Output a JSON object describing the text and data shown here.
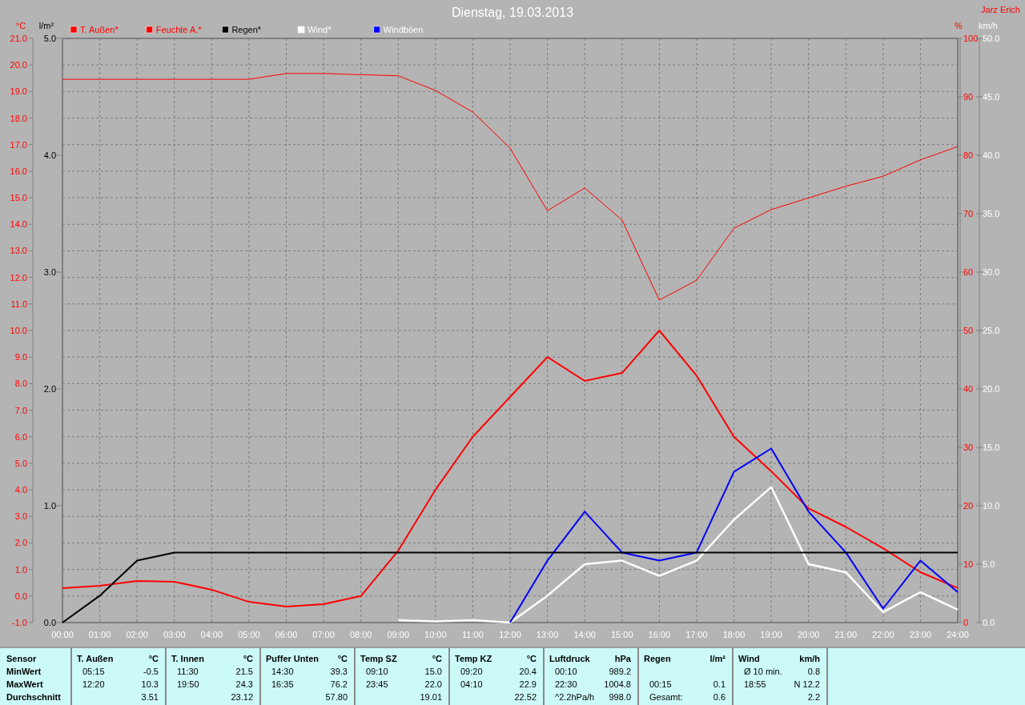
{
  "window": {
    "title": "Dienstag, 19.03.2013",
    "author": "Jarz Erich"
  },
  "chart": {
    "chart_data": {
      "type": "line",
      "grid": true,
      "legend": "top",
      "xlim": [
        0,
        24
      ],
      "x": [
        0,
        1,
        2,
        3,
        4,
        5,
        6,
        7,
        8,
        9,
        10,
        11,
        12,
        13,
        14,
        15,
        16,
        17,
        18,
        19,
        20,
        21,
        22,
        23,
        24
      ],
      "xticks": [
        {
          "value": 0,
          "label": "00:00"
        },
        {
          "value": 1,
          "label": "01:00"
        },
        {
          "value": 2,
          "label": "02:00"
        },
        {
          "value": 3,
          "label": "03:00"
        },
        {
          "value": 4,
          "label": "04:00"
        },
        {
          "value": 5,
          "label": "05:00"
        },
        {
          "value": 6,
          "label": "06:00"
        },
        {
          "value": 7,
          "label": "07:00"
        },
        {
          "value": 8,
          "label": "08:00"
        },
        {
          "value": 9,
          "label": "09:00"
        },
        {
          "value": 10,
          "label": "10:00"
        },
        {
          "value": 11,
          "label": "11:00"
        },
        {
          "value": 12,
          "label": "12:00"
        },
        {
          "value": 13,
          "label": "13:00"
        },
        {
          "value": 14,
          "label": "14:00"
        },
        {
          "value": 15,
          "label": "15:00"
        },
        {
          "value": 16,
          "label": "16:00"
        },
        {
          "value": 17,
          "label": "17:00"
        },
        {
          "value": 18,
          "label": "18:00"
        },
        {
          "value": 19,
          "label": "19:00"
        },
        {
          "value": 20,
          "label": "20:00"
        },
        {
          "value": 21,
          "label": "21:00"
        },
        {
          "value": 22,
          "label": "22:00"
        },
        {
          "value": 23,
          "label": "23:00"
        },
        {
          "value": 24,
          "label": "24:00"
        }
      ],
      "ylabel": "°C",
      "ylim": [
        -1,
        21
      ],
      "yticks": [
        {
          "value": 21,
          "label": "21.0"
        },
        {
          "value": 20,
          "label": "20.0"
        },
        {
          "value": 19,
          "label": "19.0"
        },
        {
          "value": 18,
          "label": "18.0"
        },
        {
          "value": 17,
          "label": "17.0"
        },
        {
          "value": 16,
          "label": "16.0"
        },
        {
          "value": 15,
          "label": "15.0"
        },
        {
          "value": 14,
          "label": "14.0"
        },
        {
          "value": 13,
          "label": "13.0"
        },
        {
          "value": 12,
          "label": "12.0"
        },
        {
          "value": 11,
          "label": "11.0"
        },
        {
          "value": 10,
          "label": "10.0"
        },
        {
          "value": 9,
          "label": "9.0"
        },
        {
          "value": 8,
          "label": "8.0"
        },
        {
          "value": 7,
          "label": "7.0"
        },
        {
          "value": 6,
          "label": "6.0"
        },
        {
          "value": 5,
          "label": "5.0"
        },
        {
          "value": 4,
          "label": "4.0"
        },
        {
          "value": 3,
          "label": "3.0"
        },
        {
          "value": 2,
          "label": "2.0"
        },
        {
          "value": 1,
          "label": "1.0"
        },
        {
          "value": 0,
          "label": "0.0"
        },
        {
          "value": -1,
          "label": "-1.0"
        }
      ],
      "y2label": "%",
      "y2lim": [
        0,
        100
      ],
      "y2ticks": [
        {
          "value": 100,
          "label": "100"
        },
        {
          "value": 90,
          "label": "90"
        },
        {
          "value": 80,
          "label": "80"
        },
        {
          "value": 70,
          "label": "70"
        },
        {
          "value": 60,
          "label": "60"
        },
        {
          "value": 50,
          "label": "50"
        },
        {
          "value": 40,
          "label": "40"
        },
        {
          "value": 30,
          "label": "30"
        },
        {
          "value": 20,
          "label": "20"
        },
        {
          "value": 10,
          "label": "10"
        },
        {
          "value": 0,
          "label": "0"
        }
      ],
      "y3label": "km/h",
      "y3lim": [
        0,
        50
      ],
      "y3ticks": [
        {
          "value": 50,
          "label": "50.0"
        },
        {
          "value": 45,
          "label": "45.0"
        },
        {
          "value": 40,
          "label": "40.0"
        },
        {
          "value": 35,
          "label": "35.0"
        },
        {
          "value": 30,
          "label": "30.0"
        },
        {
          "value": 25,
          "label": "25.0"
        },
        {
          "value": 20,
          "label": "20.0"
        },
        {
          "value": 15,
          "label": "15.0"
        },
        {
          "value": 10,
          "label": "10.0"
        },
        {
          "value": 5,
          "label": "5.0"
        },
        {
          "value": 0,
          "label": "0.0"
        }
      ],
      "series": [
        {
          "name": "T. Außen*",
          "color": "#ff0000",
          "values": [
            0.3,
            0.39,
            0.57,
            0.54,
            0.24,
            -0.22,
            -0.4,
            -0.31,
            0.0,
            1.71,
            4.0,
            6.0,
            7.5,
            9.0,
            8.1,
            8.4,
            10.0,
            8.3,
            6.0,
            4.7,
            3.3,
            2.6,
            1.8,
            0.9,
            0.3
          ]
        },
        {
          "name": "Feuchte A.*",
          "color": "#ff0000",
          "axis": "y2",
          "values": [
            93.0,
            93.0,
            93.0,
            93.0,
            93.0,
            93.0,
            94.0,
            94.0,
            93.8,
            93.6,
            91.1,
            87.4,
            81.2,
            70.5,
            74.4,
            68.9,
            55.2,
            58.6,
            67.5,
            70.7,
            72.7,
            74.7,
            76.4,
            79.2,
            81.5
          ]
        },
        {
          "name": "Wind*",
          "color": "#ffffff",
          "axis": "y3",
          "values": [
            null,
            null,
            null,
            null,
            null,
            null,
            null,
            null,
            null,
            0.2,
            0.1,
            0.2,
            0,
            2.3,
            5.0,
            5.3,
            4.0,
            5.3,
            8.8,
            11.6,
            5.0,
            4.3,
            0.9,
            2.6,
            1.1
          ]
        },
        {
          "name": "Windböen",
          "color": "#0000ff",
          "axis": "y3",
          "values": [
            null,
            null,
            null,
            null,
            null,
            null,
            null,
            null,
            null,
            null,
            null,
            null,
            0,
            5.3,
            9.5,
            6.0,
            5.3,
            6.0,
            12.9,
            14.9,
            9.5,
            6.0,
            1.2,
            5.3,
            2.6
          ]
        }
      ]
    }
  },
  "rain_chart": {
    "chart_data": {
      "type": "line",
      "xlim": [
        0,
        24
      ],
      "x": [
        0,
        1,
        2,
        3,
        4,
        5,
        6,
        7,
        8,
        9,
        10,
        11,
        12,
        13,
        14,
        15,
        16,
        17,
        18,
        19,
        20,
        21,
        22,
        23,
        24
      ],
      "ylabel": "l/m²",
      "ylim": [
        0,
        5
      ],
      "yticks": [
        {
          "value": 5,
          "label": "5.0"
        },
        {
          "value": 4,
          "label": "4.0"
        },
        {
          "value": 3,
          "label": "3.0"
        },
        {
          "value": 2,
          "label": "2.0"
        },
        {
          "value": 1,
          "label": "1.0"
        },
        {
          "value": 0,
          "label": "0.0"
        }
      ],
      "series": [
        {
          "name": "Regen*",
          "color": "#000000",
          "values": [
            0,
            0.23,
            0.53,
            0.6,
            0.6,
            0.6,
            0.6,
            0.6,
            0.6,
            0.6,
            0.6,
            0.6,
            0.6,
            0.6,
            0.6,
            0.6,
            0.6,
            0.6,
            0.6,
            0.6,
            0.6,
            0.6,
            0.6,
            0.6,
            0.6
          ]
        }
      ]
    }
  },
  "table": {
    "row_labels": [
      "Sensor",
      "MinWert",
      "MaxWert",
      "Durchschnitt"
    ],
    "groups": [
      {
        "name": "T. Außen",
        "unit": "°C",
        "rows": [
          {
            "time": "05:15",
            "value": "-0.5"
          },
          {
            "time": "12:20",
            "value": "10.3"
          },
          {
            "value": "3.51"
          }
        ]
      },
      {
        "name": "T. Innen",
        "unit": "°C",
        "rows": [
          {
            "time": "11:30",
            "value": "21.5"
          },
          {
            "time": "19:50",
            "value": "24.3"
          },
          {
            "value": "23.12"
          }
        ]
      },
      {
        "name": "Puffer Unten",
        "unit": "°C",
        "rows": [
          {
            "time": "14:30",
            "value": "39.3"
          },
          {
            "time": "16:35",
            "value": "76.2"
          },
          {
            "value": "57.80"
          }
        ]
      },
      {
        "name": "Temp SZ",
        "unit": "°C",
        "rows": [
          {
            "time": "09:10",
            "value": "15.0"
          },
          {
            "time": "23:45",
            "value": "22.0"
          },
          {
            "value": "19.01"
          }
        ]
      },
      {
        "name": "Temp KZ",
        "unit": "°C",
        "rows": [
          {
            "time": "09:20",
            "value": "20.4"
          },
          {
            "time": "04:10",
            "value": "22.9"
          },
          {
            "value": "22.52"
          }
        ]
      },
      {
        "name": "Luftdruck",
        "unit": "hPa",
        "rows": [
          {
            "time": "00:10",
            "value": "989.2"
          },
          {
            "time": "22:30",
            "value": "1004.8"
          },
          {
            "time": "^2.2hPa/h",
            "value": "998.0"
          }
        ]
      },
      {
        "name": "Regen",
        "unit": "l/m²",
        "rows": [
          {},
          {
            "time": "00:15",
            "value": "0.1"
          },
          {
            "time": "Gesamt:",
            "value": "0.6"
          }
        ]
      },
      {
        "name": "Wind",
        "unit": "km/h",
        "rows": [
          {
            "time": "Ø 10 min.",
            "value": "0.8"
          },
          {
            "time": "18:55",
            "value": "N 12.2"
          },
          {
            "value": "2.2"
          }
        ]
      }
    ]
  }
}
